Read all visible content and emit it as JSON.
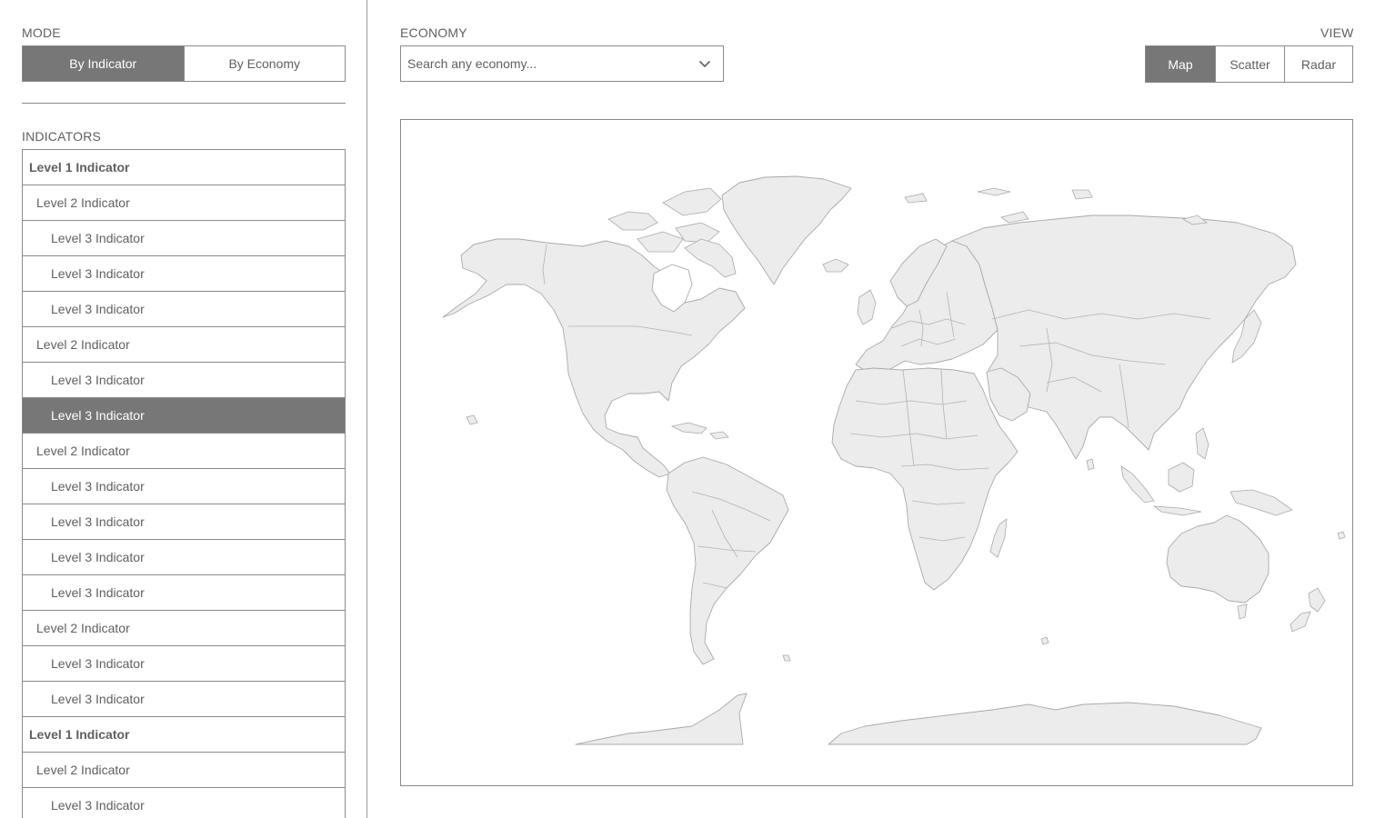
{
  "mode": {
    "label": "MODE",
    "options": [
      "By Indicator",
      "By Economy"
    ],
    "active": "By Indicator"
  },
  "indicators": {
    "label": "INDICATORS",
    "items": [
      {
        "level": 1,
        "label": "Level 1 Indicator"
      },
      {
        "level": 2,
        "label": "Level 2 Indicator"
      },
      {
        "level": 3,
        "label": "Level 3 Indicator"
      },
      {
        "level": 3,
        "label": "Level 3 Indicator"
      },
      {
        "level": 3,
        "label": "Level 3 Indicator"
      },
      {
        "level": 2,
        "label": "Level 2 Indicator"
      },
      {
        "level": 3,
        "label": "Level 3 Indicator"
      },
      {
        "level": 3,
        "label": "Level 3 Indicator",
        "selected": true
      },
      {
        "level": 2,
        "label": "Level 2 Indicator"
      },
      {
        "level": 3,
        "label": "Level 3 Indicator"
      },
      {
        "level": 3,
        "label": "Level 3 Indicator"
      },
      {
        "level": 3,
        "label": "Level 3 Indicator"
      },
      {
        "level": 3,
        "label": "Level 3 Indicator"
      },
      {
        "level": 2,
        "label": "Level 2 Indicator"
      },
      {
        "level": 3,
        "label": "Level 3 Indicator"
      },
      {
        "level": 3,
        "label": "Level 3 Indicator"
      },
      {
        "level": 1,
        "label": "Level 1 Indicator"
      },
      {
        "level": 2,
        "label": "Level 2 Indicator"
      },
      {
        "level": 3,
        "label": "Level 3 Indicator"
      }
    ]
  },
  "economy": {
    "label": "ECONOMY",
    "placeholder": "Search any economy..."
  },
  "view": {
    "label": "VIEW",
    "options": [
      "Map",
      "Scatter",
      "Radar"
    ],
    "active": "Map"
  },
  "icons": {
    "dropdown": "chevron-down-icon"
  },
  "colors": {
    "active_fill": "#777777",
    "text": "#5f5f5f",
    "border": "#8a8a8a",
    "land_fill": "#ececec",
    "land_stroke": "#a9a9a9"
  }
}
